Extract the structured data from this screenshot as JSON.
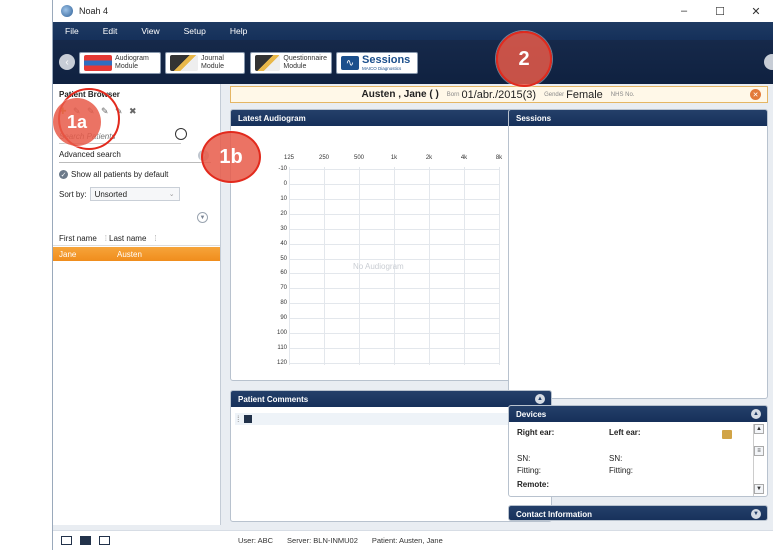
{
  "window": {
    "title": "Noah 4",
    "controls": [
      "–",
      "☐",
      "✕"
    ]
  },
  "menu": [
    "File",
    "Edit",
    "View",
    "Setup",
    "Help"
  ],
  "modules": {
    "audiogram": "Audiogram\nModule",
    "audiogram_l1": "Audiogram",
    "audiogram_l2": "Module",
    "journal_l1": "Journal",
    "journal_l2": "Module",
    "questionnaire_l1": "Questionnaire",
    "questionnaire_l2": "Module",
    "sessions_title": "Sessions",
    "sessions_sub": "MAICO Diagnostics"
  },
  "callouts": {
    "c1a": "1a",
    "c1b": "1b",
    "c2": "2"
  },
  "sidebar": {
    "title": "Patient Browser",
    "search_placeholder": "Search Patients",
    "advanced_search": "Advanced search",
    "show_all": "Show all patients by default",
    "sort_label": "Sort by:",
    "sort_value": "Unsorted",
    "col_first": "First name",
    "col_last": "Last name",
    "rows": [
      {
        "first": "Jane",
        "last": "Austen"
      }
    ]
  },
  "patient": {
    "name": "Austen , Jane ( )",
    "born_label": "Born",
    "born_value": "01/abr./2015(3)",
    "gender_label": "Gender",
    "gender_value": "Female",
    "nhs_label": "NHS No."
  },
  "panels": {
    "audiogram": "Latest Audiogram",
    "sessions": "Sessions",
    "comments": "Patient Comments",
    "devices": "Devices",
    "contact": "Contact Information"
  },
  "audiogram": {
    "freqs": [
      "125",
      "250",
      "500",
      "1k",
      "2k",
      "4k",
      "8k"
    ],
    "levels": [
      "-10",
      "0",
      "10",
      "20",
      "30",
      "40",
      "50",
      "60",
      "70",
      "80",
      "90",
      "100",
      "110",
      "120"
    ],
    "empty": "No Audiogram"
  },
  "devices": {
    "right_ear": "Right ear:",
    "left_ear": "Left ear:",
    "sn_r": "SN:",
    "sn_l": "SN:",
    "fit_r": "Fitting:",
    "fit_l": "Fitting:",
    "remote": "Remote:"
  },
  "status": {
    "user": "User: ABC",
    "server": "Server: BLN-INMU02",
    "patient": "Patient: Austen, Jane"
  }
}
